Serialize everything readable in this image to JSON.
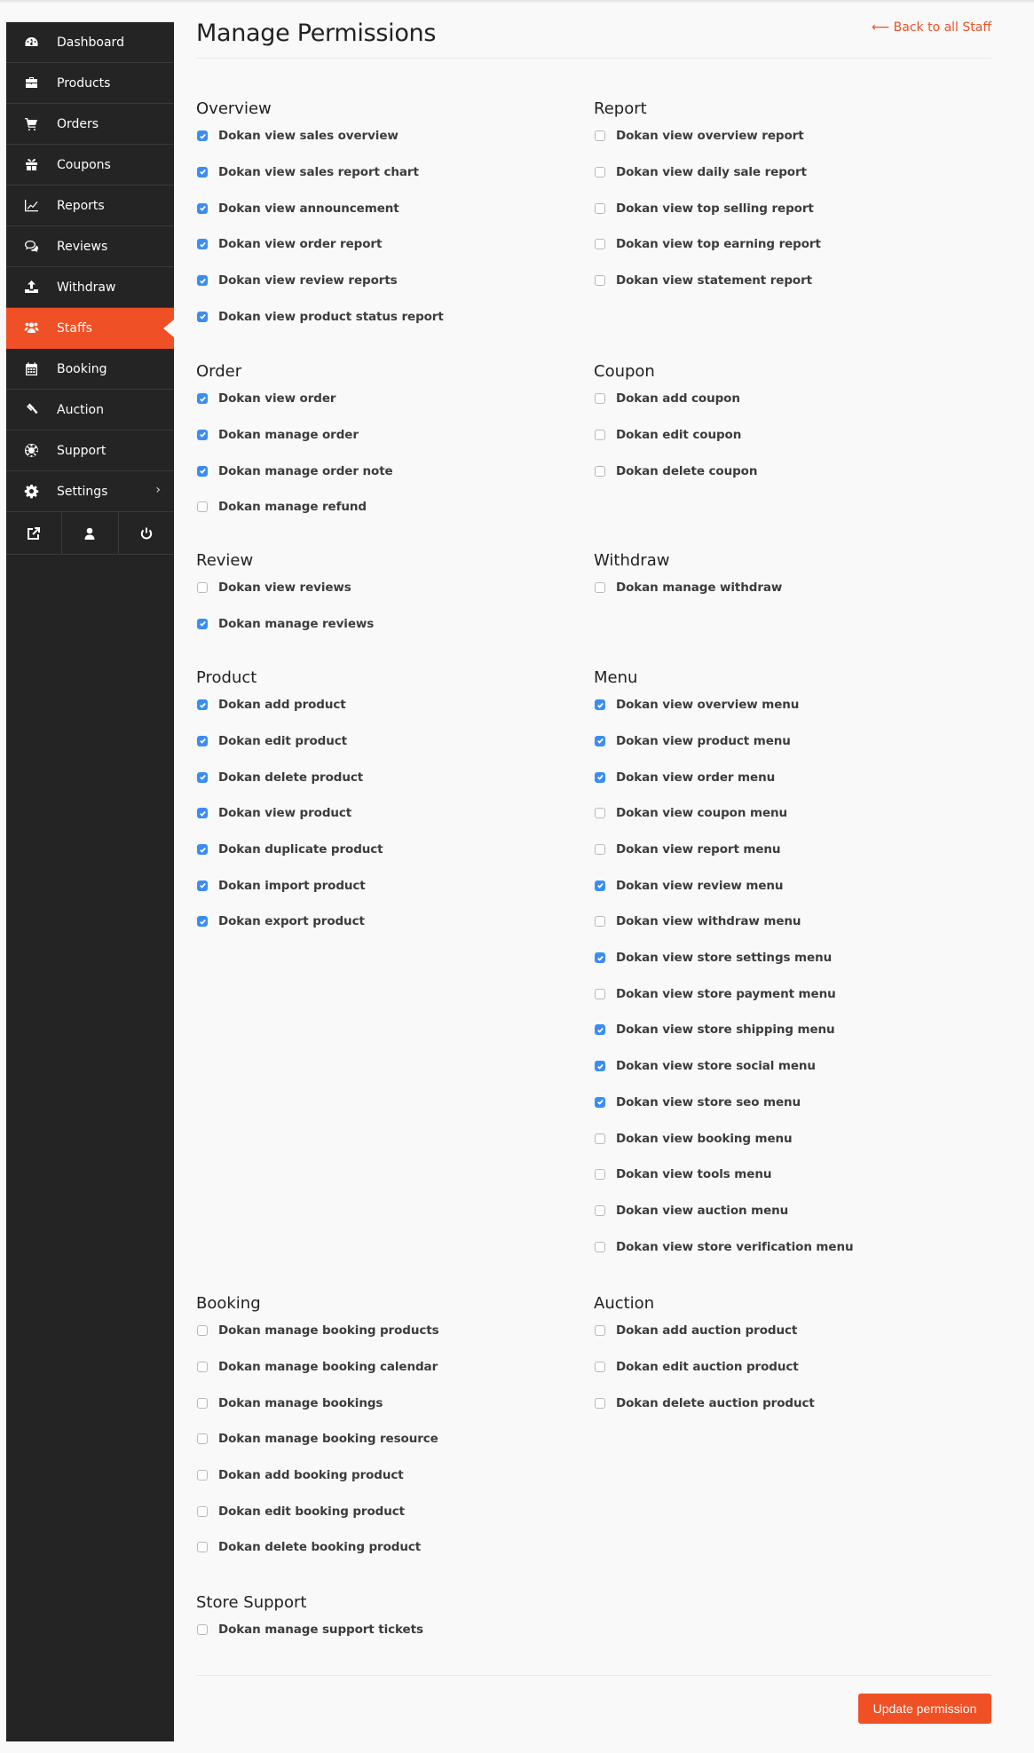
{
  "sidebar": {
    "items": [
      {
        "label": "Dashboard",
        "icon": "dashboard-icon",
        "active": false
      },
      {
        "label": "Products",
        "icon": "briefcase-icon",
        "active": false
      },
      {
        "label": "Orders",
        "icon": "cart-icon",
        "active": false
      },
      {
        "label": "Coupons",
        "icon": "gift-icon",
        "active": false
      },
      {
        "label": "Reports",
        "icon": "line-chart-icon",
        "active": false
      },
      {
        "label": "Reviews",
        "icon": "comments-icon",
        "active": false
      },
      {
        "label": "Withdraw",
        "icon": "upload-icon",
        "active": false
      },
      {
        "label": "Staffs",
        "icon": "users-icon",
        "active": true
      },
      {
        "label": "Booking",
        "icon": "calendar-icon",
        "active": false
      },
      {
        "label": "Auction",
        "icon": "gavel-icon",
        "active": false
      },
      {
        "label": "Support",
        "icon": "life-ring-icon",
        "active": false
      },
      {
        "label": "Settings",
        "icon": "gear-icon",
        "active": false,
        "has_submenu": true
      }
    ],
    "footer_icons": [
      "external-link-icon",
      "user-icon",
      "power-icon"
    ],
    "submenu_chevron": "›"
  },
  "header": {
    "title": "Manage Permissions",
    "back_link": "⟵ Back to all Staff"
  },
  "sections": {
    "overview": {
      "title": "Overview",
      "items": [
        {
          "label": "Dokan view sales overview",
          "checked": true
        },
        {
          "label": "Dokan view sales report chart",
          "checked": true
        },
        {
          "label": "Dokan view announcement",
          "checked": true
        },
        {
          "label": "Dokan view order report",
          "checked": true
        },
        {
          "label": "Dokan view review reports",
          "checked": true
        },
        {
          "label": "Dokan view product status report",
          "checked": true
        }
      ]
    },
    "report": {
      "title": "Report",
      "items": [
        {
          "label": "Dokan view overview report",
          "checked": false
        },
        {
          "label": "Dokan view daily sale report",
          "checked": false
        },
        {
          "label": "Dokan view top selling report",
          "checked": false
        },
        {
          "label": "Dokan view top earning report",
          "checked": false
        },
        {
          "label": "Dokan view statement report",
          "checked": false
        }
      ]
    },
    "order": {
      "title": "Order",
      "items": [
        {
          "label": "Dokan view order",
          "checked": true
        },
        {
          "label": "Dokan manage order",
          "checked": true
        },
        {
          "label": "Dokan manage order note",
          "checked": true
        },
        {
          "label": "Dokan manage refund",
          "checked": false
        }
      ]
    },
    "coupon": {
      "title": "Coupon",
      "items": [
        {
          "label": "Dokan add coupon",
          "checked": false
        },
        {
          "label": "Dokan edit coupon",
          "checked": false
        },
        {
          "label": "Dokan delete coupon",
          "checked": false
        }
      ]
    },
    "review": {
      "title": "Review",
      "items": [
        {
          "label": "Dokan view reviews",
          "checked": false
        },
        {
          "label": "Dokan manage reviews",
          "checked": true
        }
      ]
    },
    "withdraw": {
      "title": "Withdraw",
      "items": [
        {
          "label": "Dokan manage withdraw",
          "checked": false
        }
      ]
    },
    "product": {
      "title": "Product",
      "items": [
        {
          "label": "Dokan add product",
          "checked": true
        },
        {
          "label": "Dokan edit product",
          "checked": true
        },
        {
          "label": "Dokan delete product",
          "checked": true
        },
        {
          "label": "Dokan view product",
          "checked": true
        },
        {
          "label": "Dokan duplicate product",
          "checked": true
        },
        {
          "label": "Dokan import product",
          "checked": true
        },
        {
          "label": "Dokan export product",
          "checked": true
        }
      ]
    },
    "menu": {
      "title": "Menu",
      "items": [
        {
          "label": "Dokan view overview menu",
          "checked": true
        },
        {
          "label": "Dokan view product menu",
          "checked": true
        },
        {
          "label": "Dokan view order menu",
          "checked": true
        },
        {
          "label": "Dokan view coupon menu",
          "checked": false
        },
        {
          "label": "Dokan view report menu",
          "checked": false
        },
        {
          "label": "Dokan view review menu",
          "checked": true
        },
        {
          "label": "Dokan view withdraw menu",
          "checked": false
        },
        {
          "label": "Dokan view store settings menu",
          "checked": true
        },
        {
          "label": "Dokan view store payment menu",
          "checked": false
        },
        {
          "label": "Dokan view store shipping menu",
          "checked": true
        },
        {
          "label": "Dokan view store social menu",
          "checked": true
        },
        {
          "label": "Dokan view store seo menu",
          "checked": true
        },
        {
          "label": "Dokan view booking menu",
          "checked": false
        },
        {
          "label": "Dokan view tools menu",
          "checked": false
        },
        {
          "label": "Dokan view auction menu",
          "checked": false
        },
        {
          "label": "Dokan view store verification menu",
          "checked": false
        }
      ]
    },
    "booking": {
      "title": "Booking",
      "items": [
        {
          "label": "Dokan manage booking products",
          "checked": false
        },
        {
          "label": "Dokan manage booking calendar",
          "checked": false
        },
        {
          "label": "Dokan manage bookings",
          "checked": false
        },
        {
          "label": "Dokan manage booking resource",
          "checked": false
        },
        {
          "label": "Dokan add booking product",
          "checked": false
        },
        {
          "label": "Dokan edit booking product",
          "checked": false
        },
        {
          "label": "Dokan delete booking product",
          "checked": false
        }
      ]
    },
    "auction": {
      "title": "Auction",
      "items": [
        {
          "label": "Dokan add auction product",
          "checked": false
        },
        {
          "label": "Dokan edit auction product",
          "checked": false
        },
        {
          "label": "Dokan delete auction product",
          "checked": false
        }
      ]
    },
    "store_support": {
      "title": "Store Support",
      "items": [
        {
          "label": "Dokan manage support tickets",
          "checked": false
        }
      ]
    }
  },
  "footer": {
    "update_button": "Update permission"
  },
  "colors": {
    "accent": "#f05025",
    "sidebar_bg": "#242424",
    "checkbox_checked": "#3b8df5"
  }
}
